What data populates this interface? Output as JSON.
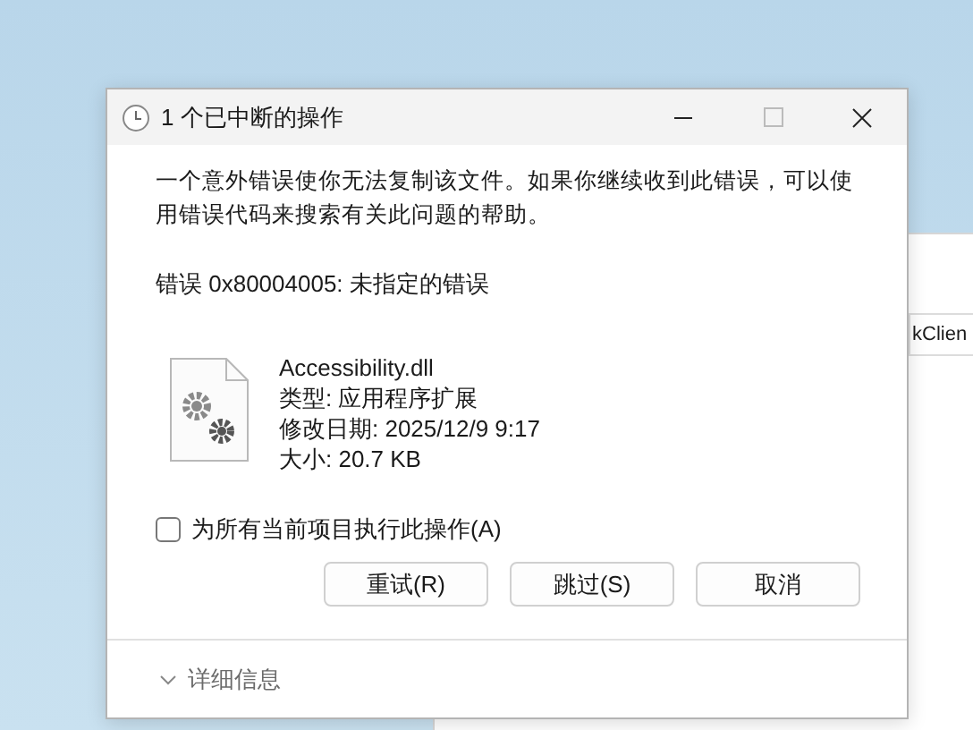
{
  "background_window": {
    "field_value": "kClien"
  },
  "window": {
    "title": "1 个已中断的操作"
  },
  "message": "一个意外错误使你无法复制该文件。如果你继续收到此错误，可以使用错误代码来搜索有关此问题的帮助。",
  "error": "错误 0x80004005: 未指定的错误",
  "file": {
    "name": "Accessibility.dll",
    "type": "类型: 应用程序扩展",
    "modified": "修改日期: 2025/12/9 9:17",
    "size": "大小: 20.7 KB"
  },
  "checkbox": {
    "label": "为所有当前项目执行此操作(A)",
    "checked": false
  },
  "buttons": [
    {
      "label": "重试(R)"
    },
    {
      "label": "跳过(S)"
    },
    {
      "label": "取消"
    }
  ],
  "details": {
    "label": "详细信息",
    "expanded": false
  }
}
